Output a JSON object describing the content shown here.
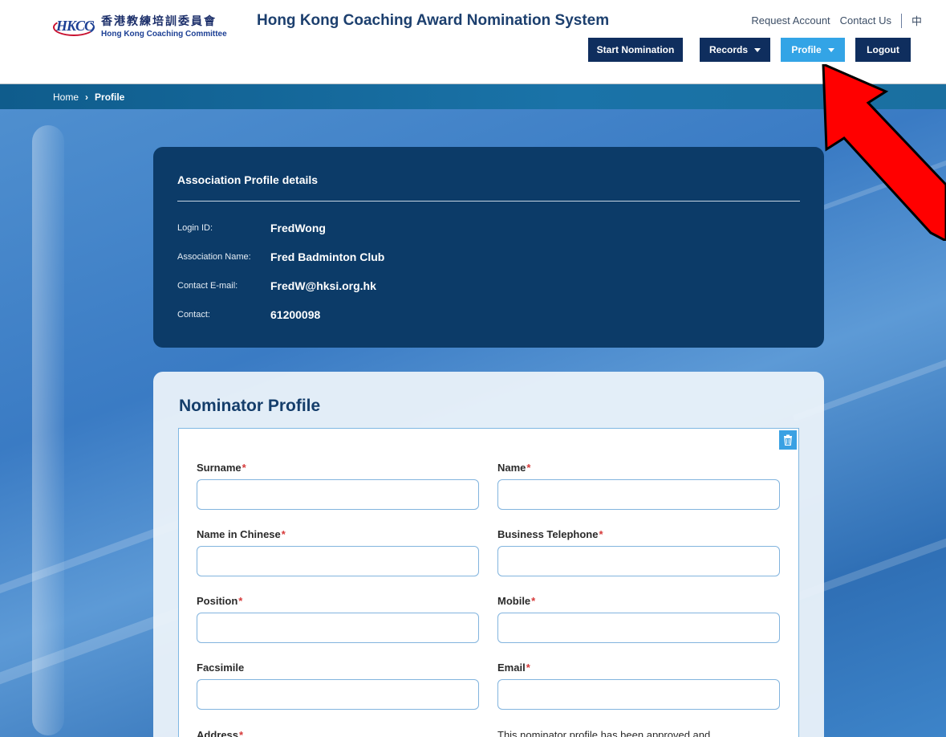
{
  "header": {
    "logo_mark": "HKCC",
    "logo_cn": "香港教練培訓委員會",
    "logo_en": "Hong Kong Coaching Committee",
    "title": "Hong Kong Coaching Award Nomination System",
    "links": {
      "request_account": "Request Account",
      "contact_us": "Contact Us",
      "language": "中"
    },
    "nav": {
      "start_nomination": "Start Nomination",
      "records": "Records",
      "profile": "Profile",
      "logout": "Logout"
    }
  },
  "breadcrumb": {
    "home": "Home",
    "separator": "›",
    "current": "Profile"
  },
  "association": {
    "title": "Association Profile details",
    "rows": [
      {
        "label": "Login ID:",
        "value": "FredWong"
      },
      {
        "label": "Association Name:",
        "value": "Fred Badminton Club"
      },
      {
        "label": "Contact E-mail:",
        "value": "FredW@hksi.org.hk"
      },
      {
        "label": "Contact:",
        "value": "61200098"
      }
    ]
  },
  "nominator": {
    "title": "Nominator Profile",
    "required_mark": "*",
    "fields": {
      "surname": {
        "label": "Surname",
        "value": ""
      },
      "name": {
        "label": "Name",
        "value": ""
      },
      "name_chinese": {
        "label": "Name in Chinese",
        "value": ""
      },
      "business_telephone": {
        "label": "Business Telephone",
        "value": ""
      },
      "position": {
        "label": "Position",
        "value": ""
      },
      "mobile": {
        "label": "Mobile",
        "value": ""
      },
      "facsimile": {
        "label": "Facsimile",
        "value": ""
      },
      "email": {
        "label": "Email",
        "value": ""
      },
      "address": {
        "label": "Address"
      }
    },
    "status_note": "This nominator profile has been approved and"
  },
  "colors": {
    "nav_dark": "#0f2e5e",
    "nav_active": "#33a4e6",
    "panel": "#0c3b68",
    "annotation_arrow": "#ff0000"
  }
}
